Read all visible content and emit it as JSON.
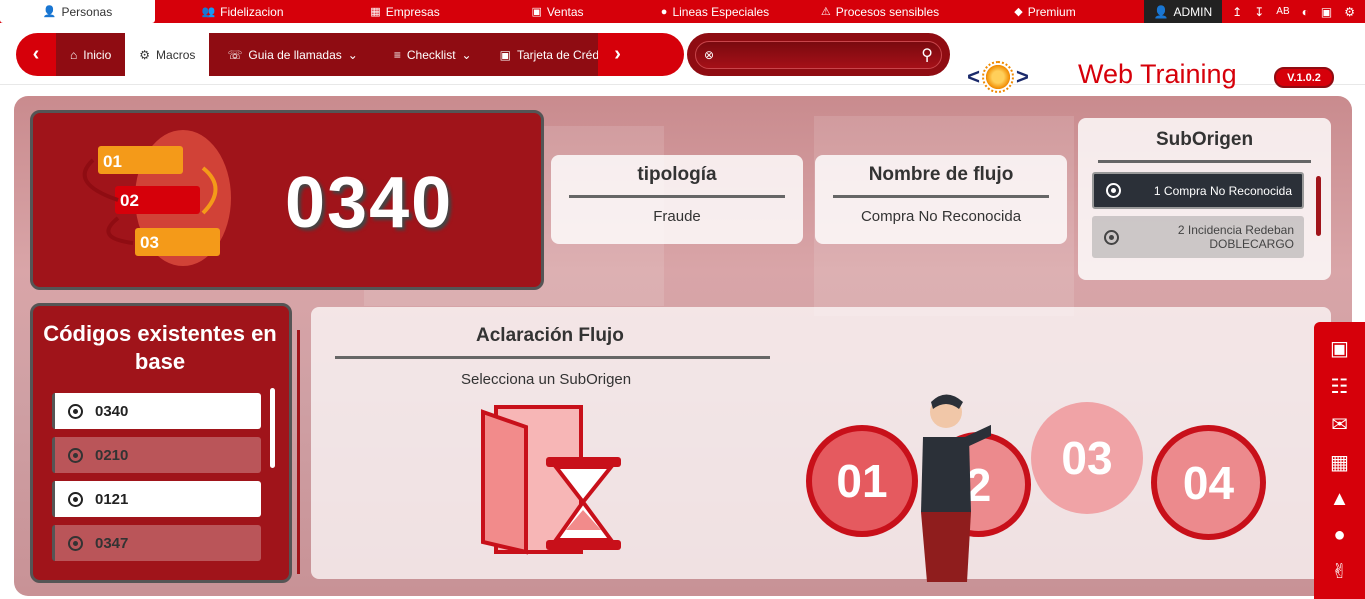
{
  "topbar": {
    "items": [
      {
        "label": "Personas",
        "icon": "user-icon"
      },
      {
        "label": "Fidelizacion",
        "icon": "users-icon"
      },
      {
        "label": "Empresas",
        "icon": "building-icon"
      },
      {
        "label": "Ventas",
        "icon": "money-icon"
      },
      {
        "label": "Lineas Especiales",
        "icon": "microphone-icon"
      },
      {
        "label": "Procesos sensibles",
        "icon": "warning-icon"
      },
      {
        "label": "Premium",
        "icon": "bag-icon"
      }
    ],
    "admin_label": "ADMIN"
  },
  "nav": {
    "tabs": [
      {
        "label": "Inicio",
        "icon": "home-icon"
      },
      {
        "label": "Macros",
        "icon": "gear-icon"
      },
      {
        "label": "Guia de llamadas",
        "icon": "phone-icon"
      },
      {
        "label": "Checklist",
        "icon": "checklist-icon"
      },
      {
        "label": "Tarjeta de Crédito",
        "icon": "card-icon"
      }
    ],
    "search_placeholder": ""
  },
  "brand": {
    "title": "Web Training",
    "version": "V.1.0.2"
  },
  "code": {
    "value": "0340"
  },
  "codes_panel": {
    "title": "Códigos existentes en base",
    "items": [
      "0340",
      "0210",
      "0121",
      "0347"
    ]
  },
  "tipologia": {
    "title": "tipología",
    "value": "Fraude"
  },
  "flujo": {
    "title": "Nombre de flujo",
    "value": "Compra No Reconocida"
  },
  "suborigen": {
    "title": "SubOrigen",
    "items": [
      "1 Compra No Reconocida",
      "2 Incidencia Redeban DOBLECARGO"
    ]
  },
  "aclaracion": {
    "title": "Aclaración Flujo",
    "subtitle": "Selecciona un SubOrigen"
  },
  "steps": [
    "01",
    "2",
    "03",
    "04"
  ],
  "colors": {
    "primary": "#d6000a",
    "dark_red": "#a0141a"
  }
}
